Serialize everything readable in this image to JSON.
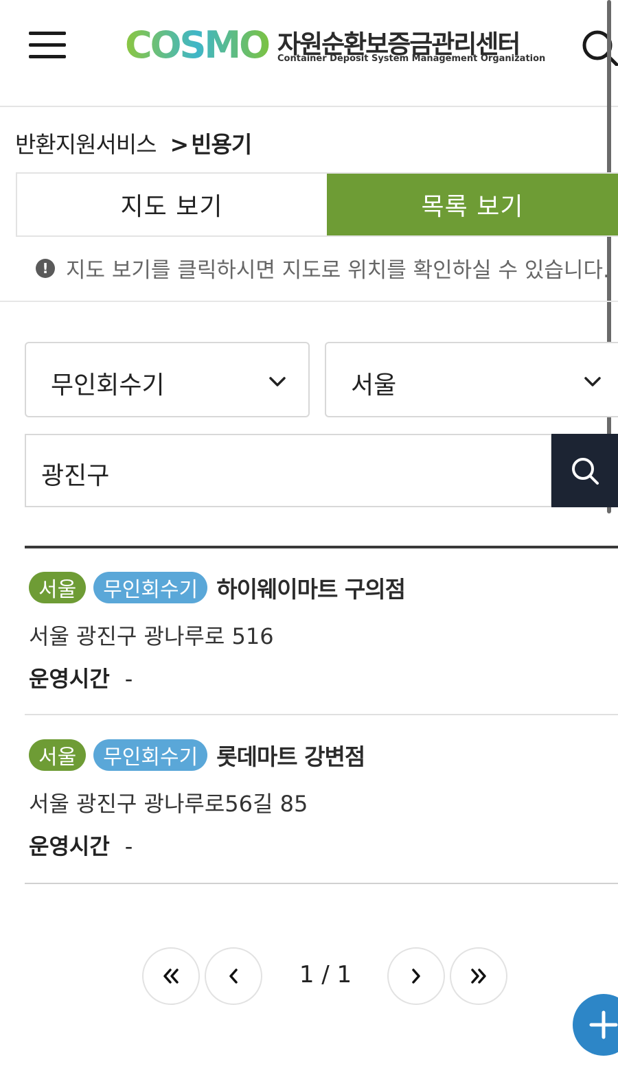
{
  "header": {
    "logo_wordmark": "COSMO",
    "logo_kr": "자원순환보증금관리센터",
    "logo_en": "Container Deposit System Management Organization"
  },
  "breadcrumb": {
    "parent": "반환지원서비스",
    "separator": ">",
    "current": "빈용기"
  },
  "view_tabs": {
    "map": "지도 보기",
    "list": "목록 보기",
    "active": "list"
  },
  "notice": {
    "icon": "!",
    "text": "지도 보기를 클릭하시면 지도로 위치를 확인하실 수 있습니다."
  },
  "filters": {
    "type_value": "무인회수기",
    "region_value": "서울"
  },
  "search": {
    "value": "광진구"
  },
  "results": [
    {
      "region": "서울",
      "type": "무인회수기",
      "name": "하이웨이마트 구의점",
      "address": "서울 광진구 광나루로 516",
      "hours_label": "운영시간",
      "hours_value": "-"
    },
    {
      "region": "서울",
      "type": "무인회수기",
      "name": "롯데마트 강변점",
      "address": "서울 광진구 광나루로56길 85",
      "hours_label": "운영시간",
      "hours_value": "-"
    }
  ],
  "pagination": {
    "info": "1 / 1"
  },
  "colors": {
    "brand_green": "#6e9c35",
    "badge_blue": "#5aa7d8",
    "search_button": "#1c2433",
    "fab_blue": "#2d86c7"
  }
}
